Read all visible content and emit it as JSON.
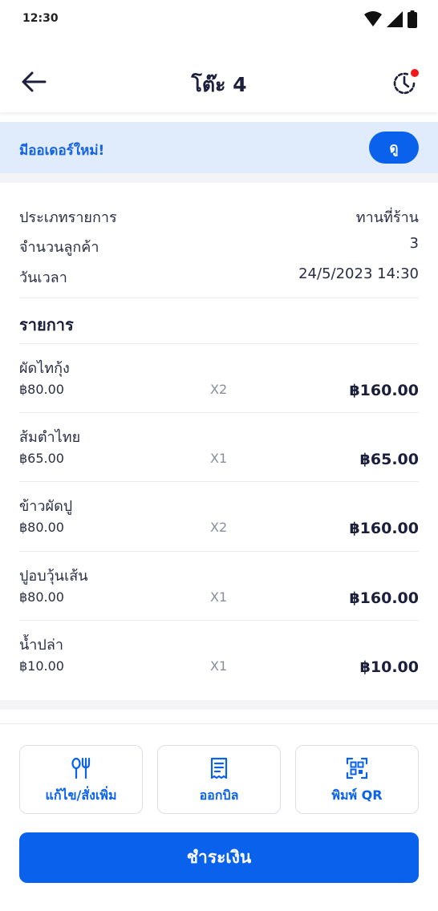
{
  "status": {
    "time": "12:30"
  },
  "header": {
    "title": "โต๊ะ 4"
  },
  "banner": {
    "text": "มีออเดอร์ใหม่!",
    "button_label": "ดู"
  },
  "order_info": [
    {
      "label": "ประเภทรายการ",
      "value": "ทานที่ร้าน"
    },
    {
      "label": "จำนวนลูกค้า",
      "value": "3"
    },
    {
      "label": "วันเวลา",
      "value": "24/5/2023 14:30"
    }
  ],
  "items_section": {
    "title": "รายการ",
    "items": [
      {
        "name": "ผัดไทกุ้ง",
        "price": "฿80.00",
        "qty": "X2",
        "total": "฿160.00"
      },
      {
        "name": "ส้มตำไทย",
        "price": "฿65.00",
        "qty": "X1",
        "total": "฿65.00"
      },
      {
        "name": "ข้าวผัดปู",
        "price": "฿80.00",
        "qty": "X2",
        "total": "฿160.00"
      },
      {
        "name": "ปูอบวุ้นเส้น",
        "price": "฿80.00",
        "qty": "X1",
        "total": "฿160.00"
      },
      {
        "name": "น้ำปล่า",
        "price": "฿10.00",
        "qty": "X1",
        "total": "฿10.00"
      }
    ]
  },
  "actions": {
    "edit_label": "แก้ไข/สั่งเพิ่ม",
    "bill_label": "ออกบิล",
    "qr_label": "พิมพ์ QR",
    "pay_label": "ชำระเงิน"
  },
  "colors": {
    "primary": "#0a61ec",
    "banner_bg": "#e0ebfb",
    "notification": "#f01818",
    "text_dark": "#1b1f3b"
  },
  "icons": {
    "back": "arrow-left-icon",
    "history": "clock-history-icon",
    "edit": "fork-knife-icon",
    "bill": "receipt-icon",
    "qr": "qr-code-icon"
  }
}
